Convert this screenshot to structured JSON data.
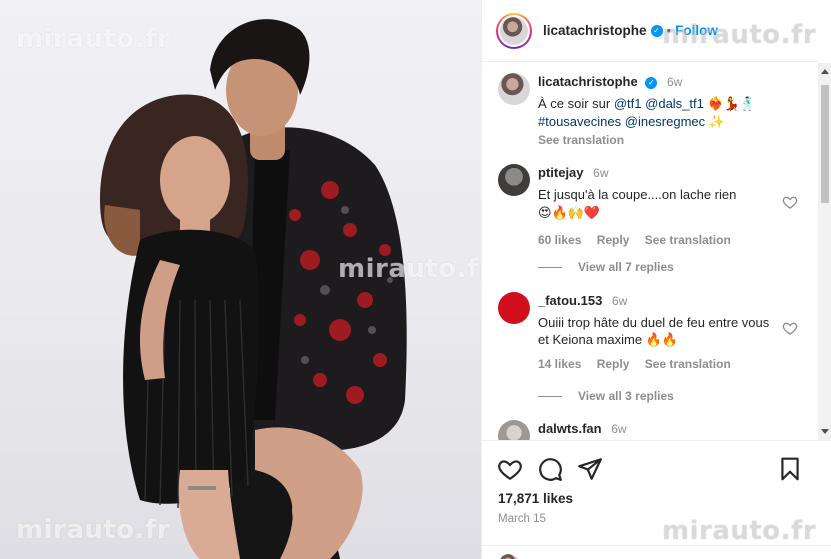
{
  "watermark": "mirauto.fr",
  "post": {
    "username": "licatachristophe",
    "follow_label": "Follow",
    "separator": "•",
    "caption": {
      "username": "licatachristophe",
      "time": "6w",
      "line1_prefix": "À ce soir sur ",
      "mention1": "@tf1",
      "mention2": "@dals_tf1",
      "line1_emojis": "❤️‍🔥💃🕺🏻",
      "hashtag": "#tousavecines",
      "mention3": "@inesregmec",
      "line2_emoji": "✨",
      "see_translation": "See translation"
    },
    "comments": [
      {
        "username": "ptitejay",
        "time": "6w",
        "text": "Et jusqu'à la coupe....on lache rien",
        "emojis": "😍🔥🙌❤️",
        "likes": "60 likes",
        "reply": "Reply",
        "see_translation": "See translation",
        "view_replies": "View all 7 replies"
      },
      {
        "username": "_fatou.153",
        "time": "6w",
        "text": "Ouiii trop hâte du duel de feu entre vous et Keiona maxime 🔥🔥",
        "likes": "14 likes",
        "reply": "Reply",
        "see_translation": "See translation",
        "view_replies": "View all 3 replies"
      },
      {
        "username": "dalwts.fan",
        "time": "6w"
      }
    ],
    "likes_count": "17,871 likes",
    "date": "March 15"
  },
  "colors": {
    "accent": "#0095f6",
    "text": "#262626",
    "muted": "#8e8e8e",
    "heart_red": "#ed4956"
  },
  "icons": {
    "like": "heart-icon",
    "comment": "comment-icon",
    "share": "share-icon",
    "save": "bookmark-icon"
  }
}
